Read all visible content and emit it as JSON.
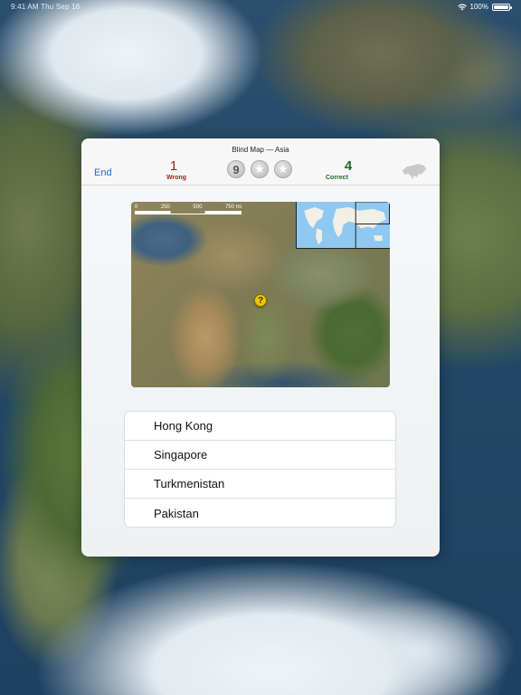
{
  "status_bar": {
    "time_date": "9:41 AM  Thu Sep 16",
    "battery": "100%",
    "battery_level": 1.0
  },
  "dialog": {
    "title": "Blind Map  —  Asia",
    "end_label": "End",
    "wrong_count": "1",
    "wrong_label": "Wrong",
    "correct_count": "4",
    "correct_label": "Correct",
    "tokens": [
      {
        "type": "number",
        "value": "9"
      },
      {
        "type": "star",
        "value": "★"
      },
      {
        "type": "star",
        "value": "★"
      }
    ]
  },
  "map": {
    "scale_labels": [
      "0",
      "250",
      "500",
      "750 mi"
    ],
    "marker_label": "?"
  },
  "answers": [
    "Hong Kong",
    "Singapore",
    "Turkmenistan",
    "Pakistan"
  ],
  "colors": {
    "accent": "#2a6bd2",
    "wrong": "#9e1e1e",
    "correct": "#1e6b22",
    "marker": "#f2c500"
  }
}
